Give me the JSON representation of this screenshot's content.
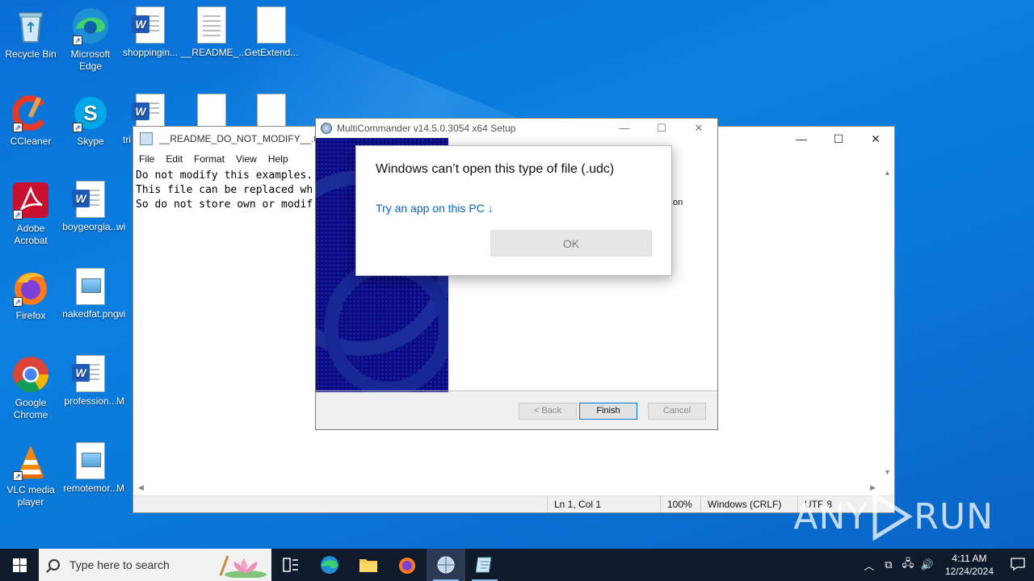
{
  "desktop": {
    "icons": [
      {
        "label": "Recycle Bin",
        "icon": "recycle-bin-icon"
      },
      {
        "label": "Microsoft Edge",
        "icon": "edge-icon"
      },
      {
        "label": "shoppingin...",
        "icon": "word-doc-icon"
      },
      {
        "label": "__README_...",
        "icon": "text-file-icon"
      },
      {
        "label": "GetExtend...",
        "icon": "blank-file-icon"
      },
      {
        "label": "CCleaner",
        "icon": "ccleaner-icon"
      },
      {
        "label": "Skype",
        "icon": "skype-icon"
      },
      {
        "label": "tri",
        "icon": "word-doc-icon"
      },
      {
        "label": "Adobe Acrobat",
        "icon": "acrobat-icon"
      },
      {
        "label": "boygeorgia...",
        "icon": "word-doc-icon"
      },
      {
        "label": "wi",
        "icon": "file-icon"
      },
      {
        "label": "Firefox",
        "icon": "firefox-icon"
      },
      {
        "label": "nakedfat.png",
        "icon": "image-file-icon"
      },
      {
        "label": "wi",
        "icon": "file-icon"
      },
      {
        "label": "Google Chrome",
        "icon": "chrome-icon"
      },
      {
        "label": "profession...",
        "icon": "word-doc-icon"
      },
      {
        "label": "M",
        "icon": "file-icon"
      },
      {
        "label": "VLC media player",
        "icon": "vlc-icon"
      },
      {
        "label": "remotemor...",
        "icon": "image-file-icon"
      },
      {
        "label": "M",
        "icon": "file-icon"
      }
    ]
  },
  "notepad": {
    "title": "__README_DO_NOT_MODIFY__.txt - N",
    "menu": [
      "File",
      "Edit",
      "Format",
      "View",
      "Help"
    ],
    "lines": [
      "Do not modify this examples.",
      "This file can be replaced wh",
      "So do not store own or modif"
    ],
    "status": {
      "position": "Ln 1, Col 1",
      "zoom": "100%",
      "line_ending": "Windows (CRLF)",
      "encoding": "UTF-8"
    }
  },
  "setup": {
    "title": "MultiCommander v14.5.0.3054 x64 Setup",
    "side_text": "on",
    "buttons": {
      "back": "< Back",
      "finish": "Finish",
      "cancel": "Cancel"
    }
  },
  "open_with": {
    "title": "Windows can’t open this type of file (.udc)",
    "link": "Try an app on this PC ↓",
    "ok": "OK"
  },
  "taskbar": {
    "search_placeholder": "Type here to search",
    "time": "4:11 AM",
    "date": "12/24/2024"
  },
  "watermark": {
    "text_left": "ANY",
    "text_right": "RUN"
  },
  "colors": {
    "desktop": "#0a78d8",
    "taskbar": "#0f1a2b",
    "link": "#0a64b4",
    "setup_banner": "#0b0a82"
  }
}
